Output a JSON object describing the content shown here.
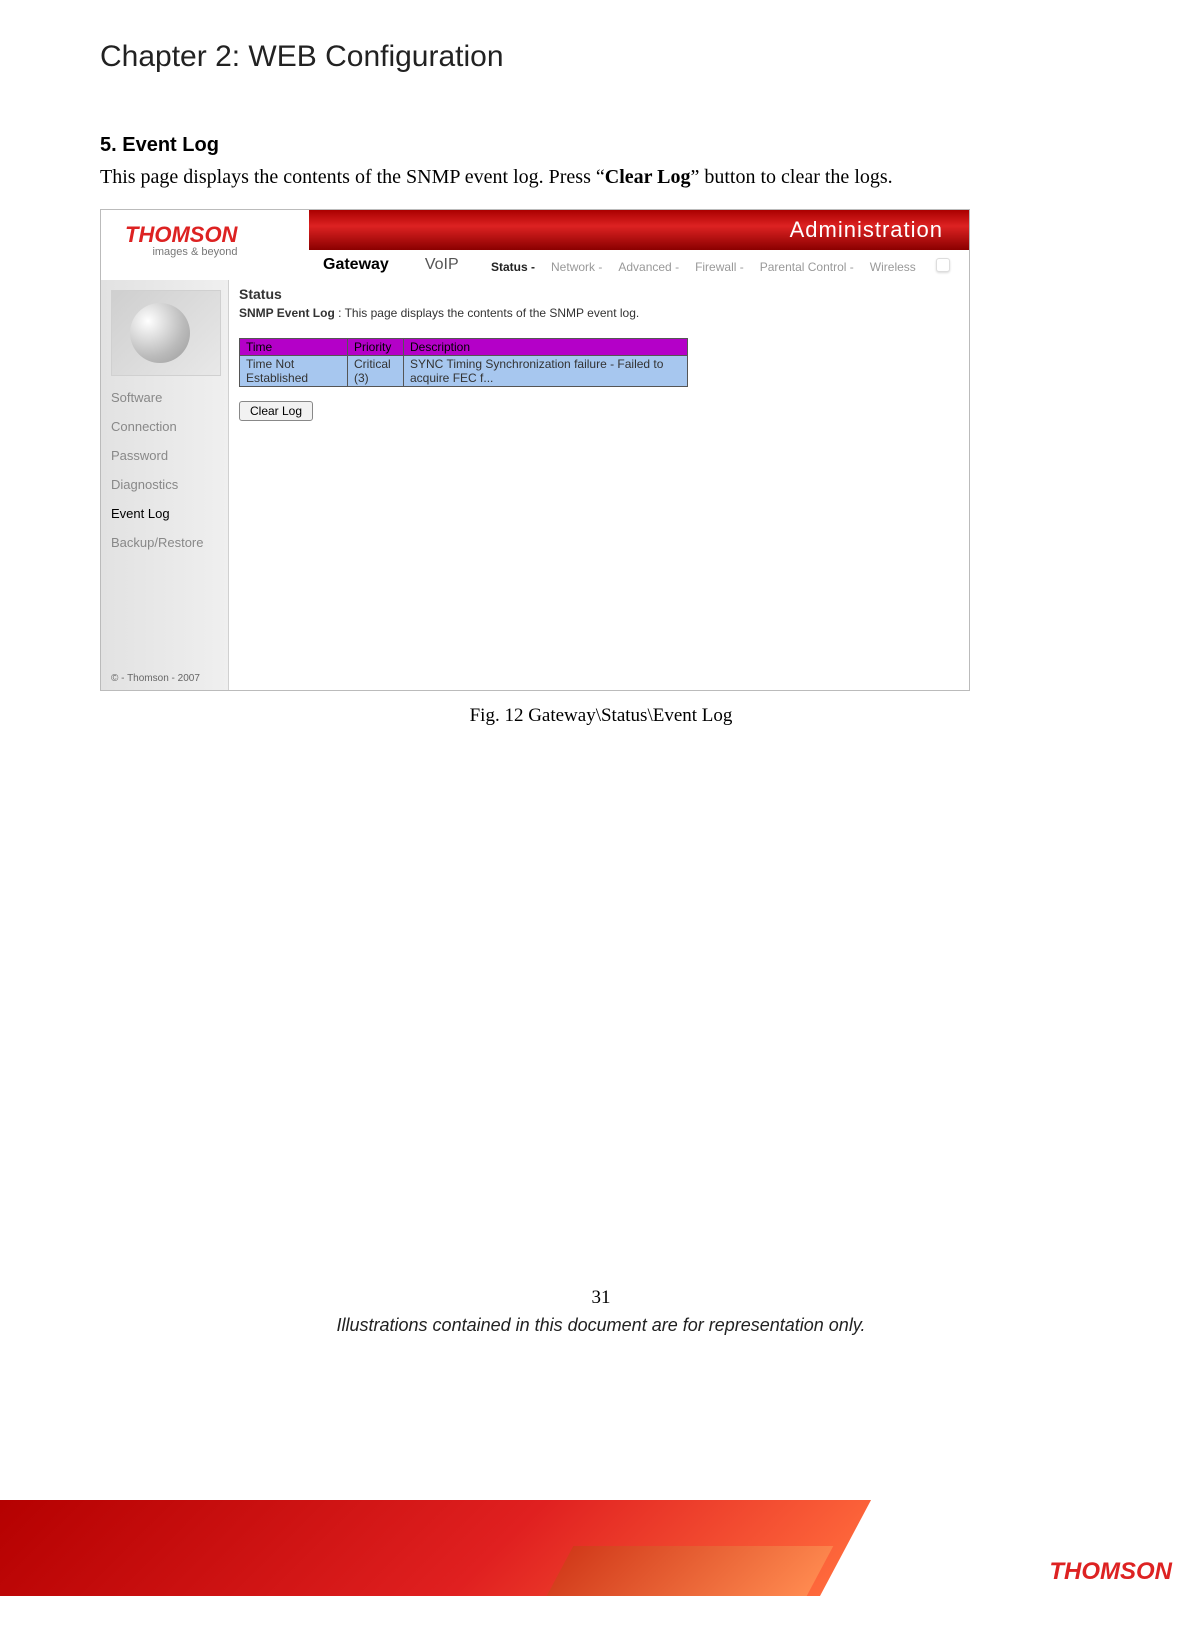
{
  "chapter_title": "Chapter 2: WEB Configuration",
  "section_heading": "5. Event Log",
  "body_text_pre": "This page displays the contents of the SNMP event log. Press “",
  "body_text_bold": "Clear Log",
  "body_text_post": "” button to clear the logs.",
  "figure_caption": "Fig. 12 Gateway\\Status\\Event Log",
  "page_number": "31",
  "rep_note": "Illustrations contained in this document are for representation only.",
  "footer_logo": "THOMSON",
  "screenshot": {
    "logo_text": "THOMSON",
    "logo_sub": "images & beyond",
    "banner_title": "Administration",
    "tabs": {
      "gateway": "Gateway",
      "voip": "VoIP"
    },
    "subnav": {
      "status": "Status -",
      "network": "Network -",
      "advanced": "Advanced -",
      "firewall": "Firewall -",
      "parental": "Parental Control -",
      "wireless": "Wireless"
    },
    "side": {
      "software": "Software",
      "connection": "Connection",
      "password": "Password",
      "diagnostics": "Diagnostics",
      "event_log": "Event Log",
      "backup": "Backup/Restore",
      "copyright": "© - Thomson - 2007"
    },
    "status_title": "Status",
    "content_label": "SNMP Event Log",
    "content_sep": " : ",
    "content_desc": "This page displays the contents of the SNMP event log.",
    "table": {
      "headers": {
        "time": "Time",
        "priority": "Priority",
        "description": "Description"
      },
      "row": {
        "time": "Time Not Established",
        "priority": "Critical (3)",
        "description": "SYNC Timing Synchronization failure - Failed to acquire FEC f..."
      }
    },
    "clear_btn": "Clear Log"
  }
}
